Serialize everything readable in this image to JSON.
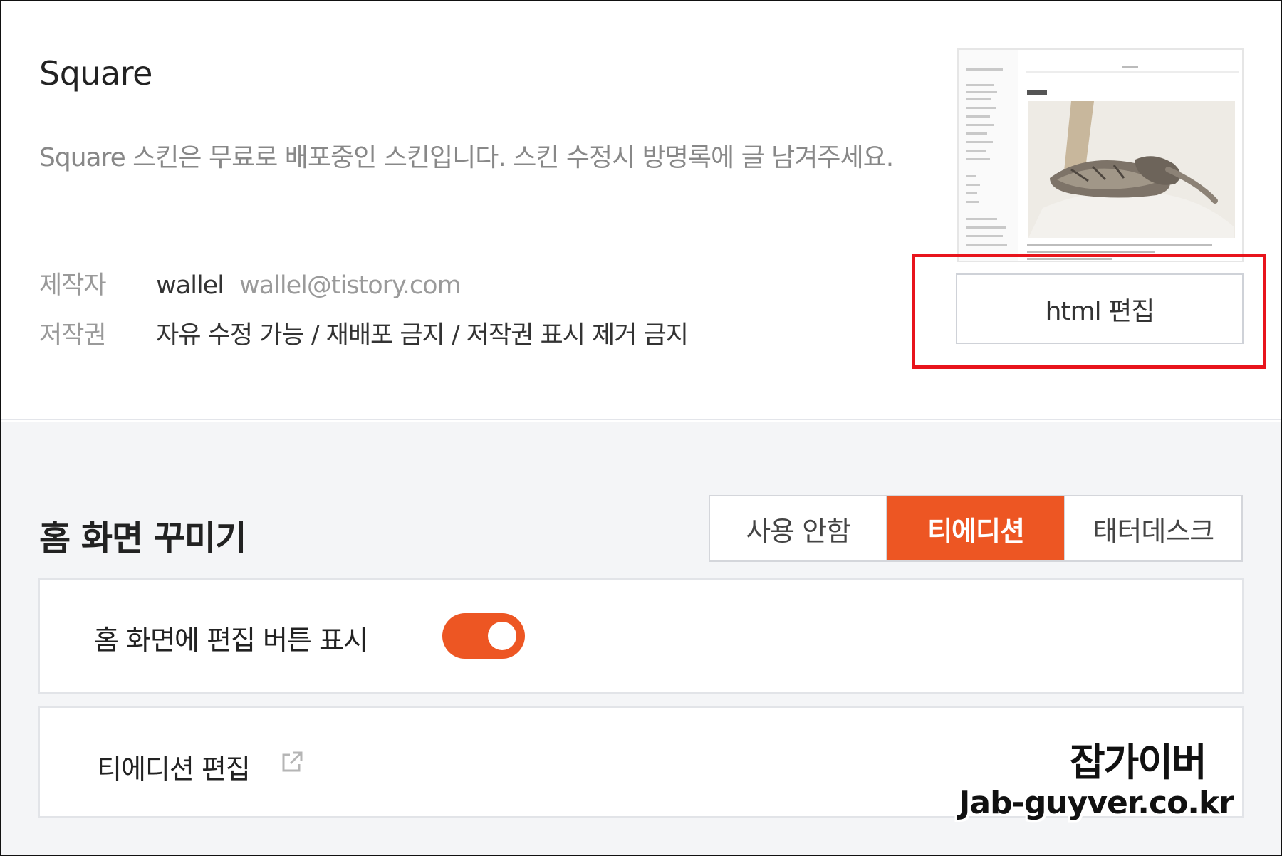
{
  "skin": {
    "title": "Square",
    "description": "Square 스킨은 무료로 배포중인 스킨입니다. 스킨 수정시 방명록에 글 남겨주세요.",
    "author_label": "제작자",
    "author_name": "wallel",
    "author_email": "wallel@tistory.com",
    "license_label": "저작권",
    "license_value": "자유 수정 가능 / 재배포 금지 / 저작권 표시 제거 금지",
    "html_edit_label": "html 편집"
  },
  "home": {
    "title": "홈 화면 꾸미기",
    "options": [
      {
        "label": "사용 안함",
        "active": false
      },
      {
        "label": "티에디션",
        "active": true
      },
      {
        "label": "태터데스크",
        "active": false
      }
    ],
    "toggle_label": "홈 화면에 편집 버튼 표시",
    "toggle_on": true,
    "edition_edit_label": "티에디션 편집"
  },
  "watermark": {
    "name": "잡가이버",
    "url": "Jab-guyver.co.kr"
  },
  "colors": {
    "accent": "#ed5623",
    "highlight": "#e8141c"
  },
  "icons": {
    "edition_edit": "external-link-icon"
  }
}
